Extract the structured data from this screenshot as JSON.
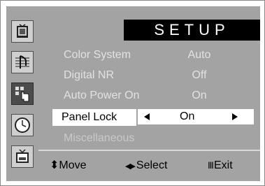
{
  "menu": {
    "title": "SETUP",
    "items": [
      {
        "label": "Color System",
        "value": "Auto"
      },
      {
        "label": "Digital NR",
        "value": "Off"
      },
      {
        "label": "Auto Power On",
        "value": "On"
      },
      {
        "label": "Panel Lock",
        "value": "On",
        "selected": true
      },
      {
        "label": "Miscellaneous",
        "value": ""
      }
    ]
  },
  "sidebar": {
    "icons": [
      "tv-picture-icon",
      "sound-icon",
      "setup-icon",
      "clock-icon",
      "input-icon"
    ],
    "active": "setup-icon"
  },
  "footer": {
    "move_label": "Move",
    "select_label": "Select",
    "exit_label": "Exit",
    "move_glyph": "⬍",
    "select_glyph": "◀▶",
    "exit_glyph": "Ⅲ"
  },
  "colors": {
    "osd_background": "#a3a3a3",
    "title_background": "#000000",
    "title_text": "#ffffff",
    "highlight": "#ffffff"
  }
}
